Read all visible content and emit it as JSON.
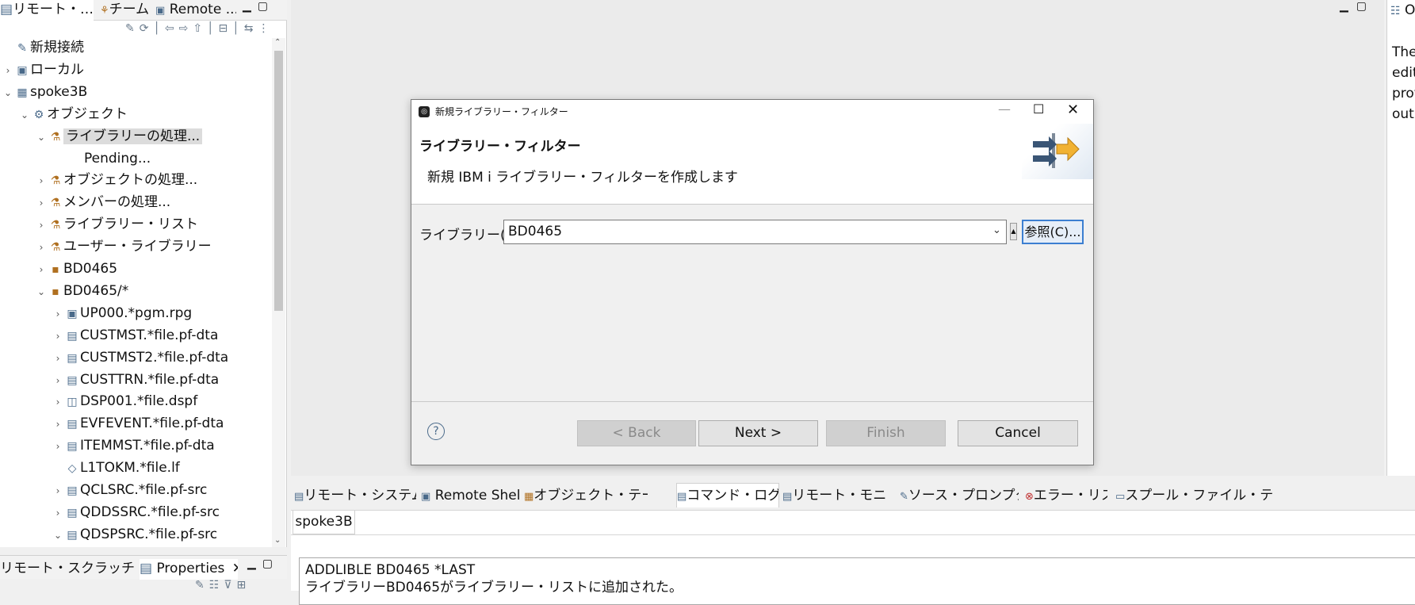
{
  "left_panel": {
    "tabs": [
      "リモート・…",
      "チーム",
      "Remote ..."
    ],
    "tree": [
      {
        "label": "新規接続",
        "indent": 0,
        "twisty": "",
        "icon": "new-connection-icon"
      },
      {
        "label": "ローカル",
        "indent": 0,
        "twisty": "›",
        "icon": "local-system-icon"
      },
      {
        "label": "spoke3B",
        "indent": 0,
        "twisty": "⌄",
        "icon": "system-icon"
      },
      {
        "label": "オブジェクト",
        "indent": 1,
        "twisty": "⌄",
        "icon": "objects-icon"
      },
      {
        "label": "ライブラリーの処理...",
        "indent": 2,
        "twisty": "⌄",
        "icon": "library-filter-icon",
        "selected": true
      },
      {
        "label": "Pending...",
        "indent": 4,
        "twisty": "",
        "icon": ""
      },
      {
        "label": "オブジェクトの処理...",
        "indent": 2,
        "twisty": "›",
        "icon": "object-filter-icon"
      },
      {
        "label": "メンバーの処理...",
        "indent": 2,
        "twisty": "›",
        "icon": "member-filter-icon"
      },
      {
        "label": "ライブラリー・リスト",
        "indent": 2,
        "twisty": "›",
        "icon": "library-list-icon"
      },
      {
        "label": "ユーザー・ライブラリー",
        "indent": 2,
        "twisty": "›",
        "icon": "user-library-icon"
      },
      {
        "label": "BD0465",
        "indent": 2,
        "twisty": "›",
        "icon": "library-icon"
      },
      {
        "label": "BD0465/*",
        "indent": 2,
        "twisty": "⌄",
        "icon": "library-icon"
      },
      {
        "label": "UP000.*pgm.rpg",
        "indent": 3,
        "twisty": "›",
        "icon": "program-icon"
      },
      {
        "label": "CUSTMST.*file.pf-dta",
        "indent": 3,
        "twisty": "›",
        "icon": "file-icon"
      },
      {
        "label": "CUSTMST2.*file.pf-dta",
        "indent": 3,
        "twisty": "›",
        "icon": "file-icon"
      },
      {
        "label": "CUSTTRN.*file.pf-dta",
        "indent": 3,
        "twisty": "›",
        "icon": "file-icon"
      },
      {
        "label": "DSP001.*file.dspf",
        "indent": 3,
        "twisty": "›",
        "icon": "display-file-icon"
      },
      {
        "label": "EVFEVENT.*file.pf-dta",
        "indent": 3,
        "twisty": "›",
        "icon": "file-icon"
      },
      {
        "label": "ITEMMST.*file.pf-dta",
        "indent": 3,
        "twisty": "›",
        "icon": "file-icon"
      },
      {
        "label": "L1TOKM.*file.lf",
        "indent": 3,
        "twisty": "",
        "icon": "logical-file-icon"
      },
      {
        "label": "QCLSRC.*file.pf-src",
        "indent": 3,
        "twisty": "›",
        "icon": "source-file-icon"
      },
      {
        "label": "QDDSSRC.*file.pf-src",
        "indent": 3,
        "twisty": "›",
        "icon": "source-file-icon"
      },
      {
        "label": "QDSPSRC.*file.pf-src",
        "indent": 3,
        "twisty": "⌄",
        "icon": "source-file-icon"
      }
    ]
  },
  "bottom_left": {
    "tabs": [
      "リモート・スクラッチパ...",
      "Properties"
    ]
  },
  "right_strip": {
    "title": "O",
    "lines": [
      "Ther",
      "edit",
      "prov",
      "outl"
    ]
  },
  "dialog": {
    "window_title": "新規ライブラリー・フィルター",
    "heading": "ライブラリー・フィルター",
    "description": "新規 IBM i ライブラリー・フィルターを作成します",
    "library_label": "ライブラリー(A):",
    "library_value": "BD0465",
    "browse_label": "参照(C)...",
    "buttons": {
      "back": "< Back",
      "next": "Next >",
      "finish": "Finish",
      "cancel": "Cancel"
    }
  },
  "bottom_panel": {
    "tabs": [
      "リモート・システム詳細",
      "Remote Shell",
      "オブジェクト・テーブル",
      "コマンド・ログ",
      "リモート・モニター",
      "ソース・プロンプター",
      "エラー・リスト",
      "スプール・ファイル・テーブル"
    ],
    "active_tab": "コマンド・ログ",
    "subtab": "spoke3B",
    "log_lines": [
      "ADDLIBLE BD0465 *LAST",
      "ライブラリーBD0465がライブラリー・リストに追加された。"
    ]
  }
}
